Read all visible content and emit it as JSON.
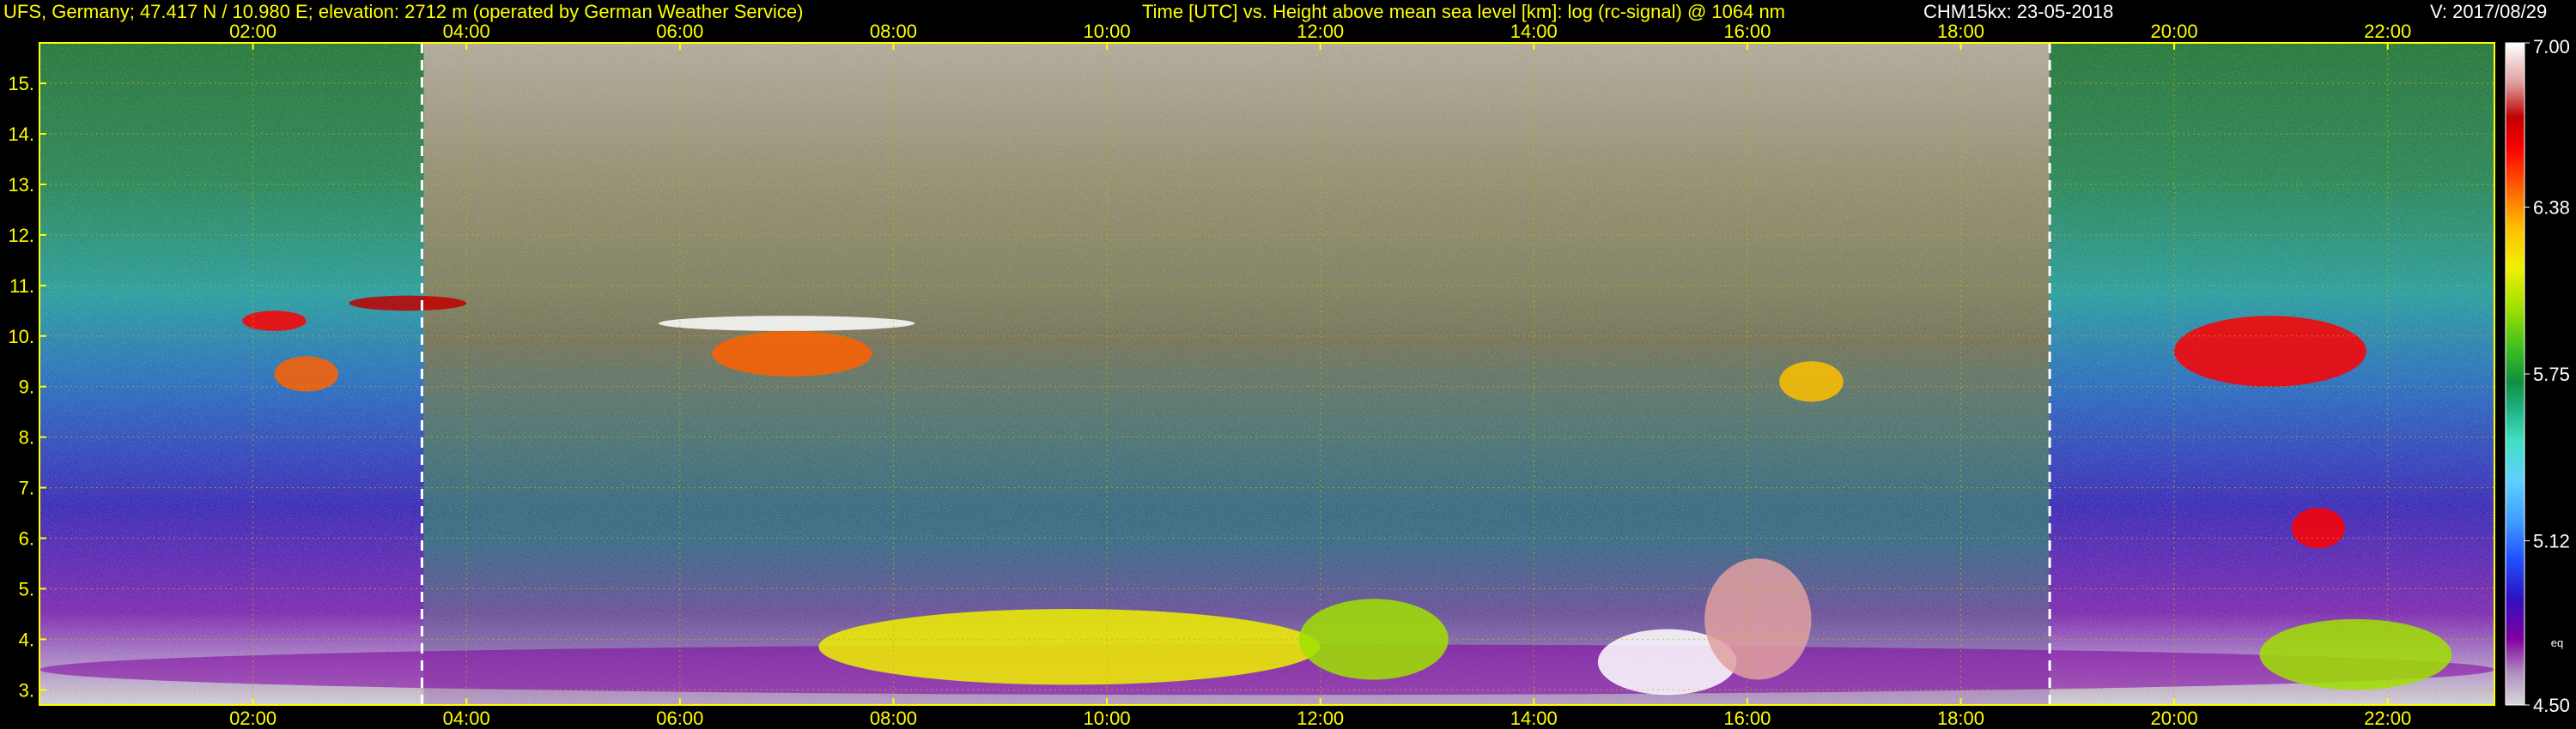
{
  "header": {
    "station": "UFS, Germany; 47.417 N / 10.980 E; elevation: 2712 m  (operated by German Weather Service)",
    "axes_description": "Time [UTC] vs. Height above mean sea level [km]: log (rc-signal) @ 1064 nm",
    "instrument_date": "CHM15kx: 23-05-2018",
    "version": "V: 2017/08/29"
  },
  "colors": {
    "text_yellow": "#ffff00",
    "text_white": "#ffffff",
    "background": "#000000",
    "plot_frame": "#ffff00",
    "gridline": "#c8b400",
    "marker_line": "#ffffff"
  },
  "chart_data": {
    "type": "heatmap",
    "xlabel": "Time [UTC]",
    "ylabel": "Height above mean sea level [km]",
    "xlim": [
      "00:00",
      "23:00"
    ],
    "ylim": [
      2.7,
      15.8
    ],
    "x_ticks": [
      "02:00",
      "04:00",
      "06:00",
      "08:00",
      "10:00",
      "12:00",
      "14:00",
      "16:00",
      "18:00",
      "20:00",
      "22:00"
    ],
    "y_ticks": [
      "3.",
      "4.",
      "5.",
      "6.",
      "7.",
      "8.",
      "9.",
      "10.",
      "11.",
      "12.",
      "13.",
      "14.",
      "15."
    ],
    "grid": true,
    "vertical_markers": [
      "03:35",
      "18:50"
    ],
    "colorbar": {
      "label": "log (rc-signal)",
      "min": 4.5,
      "max": 7.0,
      "tick_labels": [
        "7.00",
        "6.38",
        "5.75",
        "5.12",
        "4.50"
      ],
      "side_label": "eq",
      "stops": [
        {
          "v": 4.5,
          "c": "#d8d8d8"
        },
        {
          "v": 4.62,
          "c": "#b090c0"
        },
        {
          "v": 4.75,
          "c": "#8000a0"
        },
        {
          "v": 4.9,
          "c": "#3010c0"
        },
        {
          "v": 5.05,
          "c": "#2050ff"
        },
        {
          "v": 5.2,
          "c": "#40a0ff"
        },
        {
          "v": 5.35,
          "c": "#60d0ff"
        },
        {
          "v": 5.5,
          "c": "#40e0c0"
        },
        {
          "v": 5.62,
          "c": "#20b080"
        },
        {
          "v": 5.72,
          "c": "#109040"
        },
        {
          "v": 5.85,
          "c": "#40c020"
        },
        {
          "v": 6.0,
          "c": "#a0e000"
        },
        {
          "v": 6.15,
          "c": "#f0f000"
        },
        {
          "v": 6.3,
          "c": "#ffc000"
        },
        {
          "v": 6.45,
          "c": "#ff6000"
        },
        {
          "v": 6.6,
          "c": "#ff0000"
        },
        {
          "v": 6.72,
          "c": "#c00000"
        },
        {
          "v": 6.85,
          "c": "#e0a0a0"
        },
        {
          "v": 7.0,
          "c": "#ffffff"
        }
      ]
    },
    "features": [
      {
        "name": "boundary layer",
        "x": [
          0.0,
          23.0
        ],
        "y": [
          2.9,
          3.9
        ],
        "value": 4.7
      },
      {
        "name": "cloud",
        "x": [
          1.9,
          2.5
        ],
        "y": [
          10.1,
          10.5
        ],
        "value": 6.5
      },
      {
        "name": "cloud",
        "x": [
          2.2,
          2.8
        ],
        "y": [
          8.9,
          9.6
        ],
        "value": 6.4
      },
      {
        "name": "cloud",
        "x": [
          2.9,
          4.0
        ],
        "y": [
          10.5,
          10.8
        ],
        "value": 6.7
      },
      {
        "name": "cloud",
        "x": [
          5.8,
          8.2
        ],
        "y": [
          10.1,
          10.4
        ],
        "value": 6.9
      },
      {
        "name": "cloud",
        "x": [
          6.3,
          7.8
        ],
        "y": [
          9.2,
          10.1
        ],
        "value": 6.35
      },
      {
        "name": "aerosol",
        "x": [
          7.3,
          12.0
        ],
        "y": [
          3.1,
          4.6
        ],
        "value": 6.1
      },
      {
        "name": "aerosol",
        "x": [
          11.8,
          13.2
        ],
        "y": [
          3.2,
          4.8
        ],
        "value": 5.9
      },
      {
        "name": "aerosol",
        "x": [
          14.6,
          15.9
        ],
        "y": [
          2.9,
          4.2
        ],
        "value": 6.9
      },
      {
        "name": "cloud",
        "x": [
          15.6,
          16.6
        ],
        "y": [
          3.2,
          5.6
        ],
        "value": 6.8
      },
      {
        "name": "cloud",
        "x": [
          16.3,
          16.9
        ],
        "y": [
          8.7,
          9.5
        ],
        "value": 6.3
      },
      {
        "name": "cloud",
        "x": [
          20.0,
          21.8
        ],
        "y": [
          9.0,
          10.4
        ],
        "value": 6.6
      },
      {
        "name": "cloud",
        "x": [
          21.1,
          21.6
        ],
        "y": [
          5.8,
          6.6
        ],
        "value": 6.5
      },
      {
        "name": "aerosol",
        "x": [
          20.8,
          22.6
        ],
        "y": [
          3.0,
          4.4
        ],
        "value": 6.0
      }
    ]
  }
}
